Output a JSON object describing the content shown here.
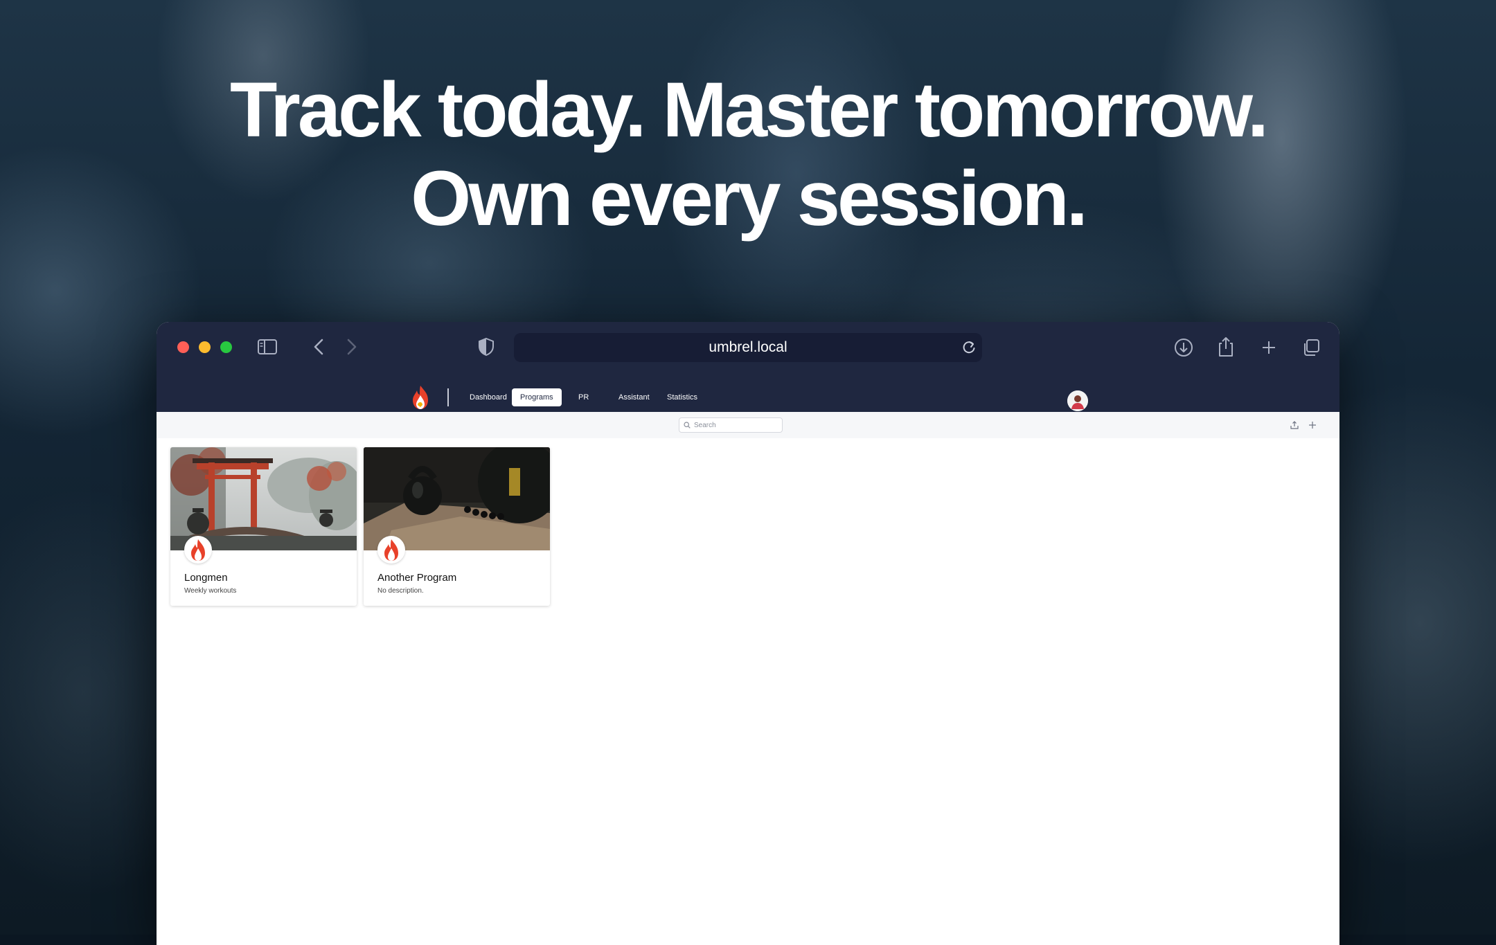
{
  "headline": {
    "line1": "Track today. Master tomorrow.",
    "line2": "Own every session."
  },
  "browser": {
    "url": "umbrel.local",
    "icons": [
      "sidebar-icon",
      "back-icon",
      "forward-icon",
      "shield-icon",
      "reload-icon",
      "download-icon",
      "share-icon",
      "plus-icon",
      "tabs-icon"
    ]
  },
  "app": {
    "nav": [
      {
        "label": "Dashboard",
        "active": false
      },
      {
        "label": "Programs",
        "active": true
      },
      {
        "label": "PR",
        "active": false
      },
      {
        "label": "Assistant",
        "active": false
      },
      {
        "label": "Statistics",
        "active": false
      }
    ],
    "search_placeholder": "Search",
    "programs": [
      {
        "title": "Longmen",
        "description": "Weekly workouts"
      },
      {
        "title": "Another Program",
        "description": "No description."
      }
    ]
  },
  "colors": {
    "chrome": "#1f2740",
    "urlbar": "#171d35",
    "accent_flame": "#e8412a"
  }
}
